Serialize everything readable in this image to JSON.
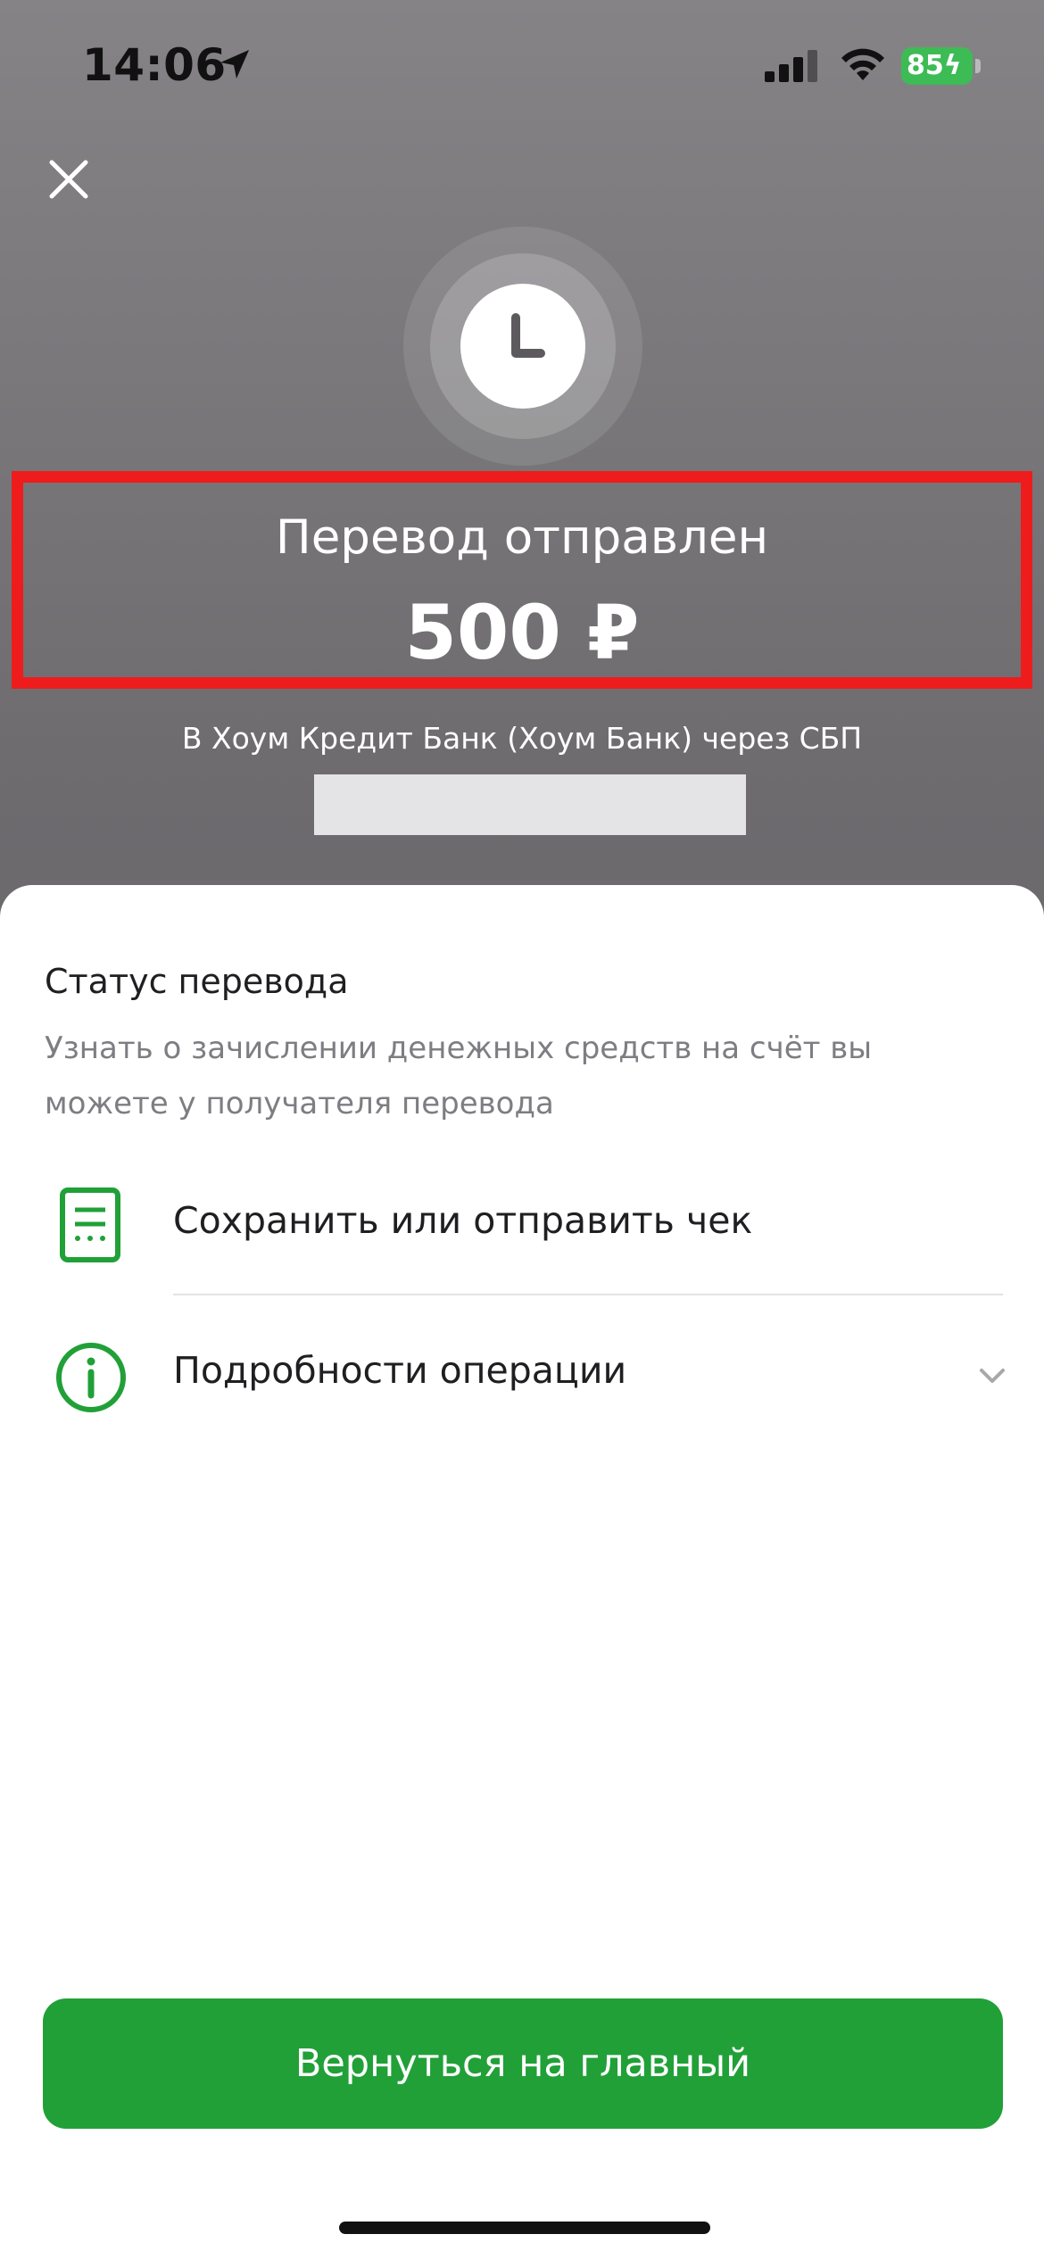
{
  "status_bar": {
    "time": "14:06",
    "battery": "85",
    "icons": [
      "location-arrow-icon",
      "cellular-signal-icon",
      "wifi-icon",
      "battery-charging-icon"
    ]
  },
  "header": {
    "close_icon": "close-icon",
    "illustration_icon": "clock-icon",
    "title": "Перевод отправлен",
    "amount": "500 ₽",
    "subtitle": "В Хоум Кредит Банк (Хоум Банк) через СБП"
  },
  "sheet": {
    "status_title": "Статус перевода",
    "status_description": "Узнать о зачислении денежных средств на счёт вы можете у получателя перевода",
    "items": [
      {
        "label": "Сохранить или отправить чек",
        "icon": "receipt-icon"
      },
      {
        "label": "Подробности операции",
        "icon": "info-icon",
        "trailing_icon": "chevron-down-icon"
      }
    ],
    "primary_button": "Вернуться на главный"
  },
  "colors": {
    "accent_green": "#21a038",
    "highlight_red": "#ee1c1c",
    "battery_green": "#3dbb55"
  }
}
